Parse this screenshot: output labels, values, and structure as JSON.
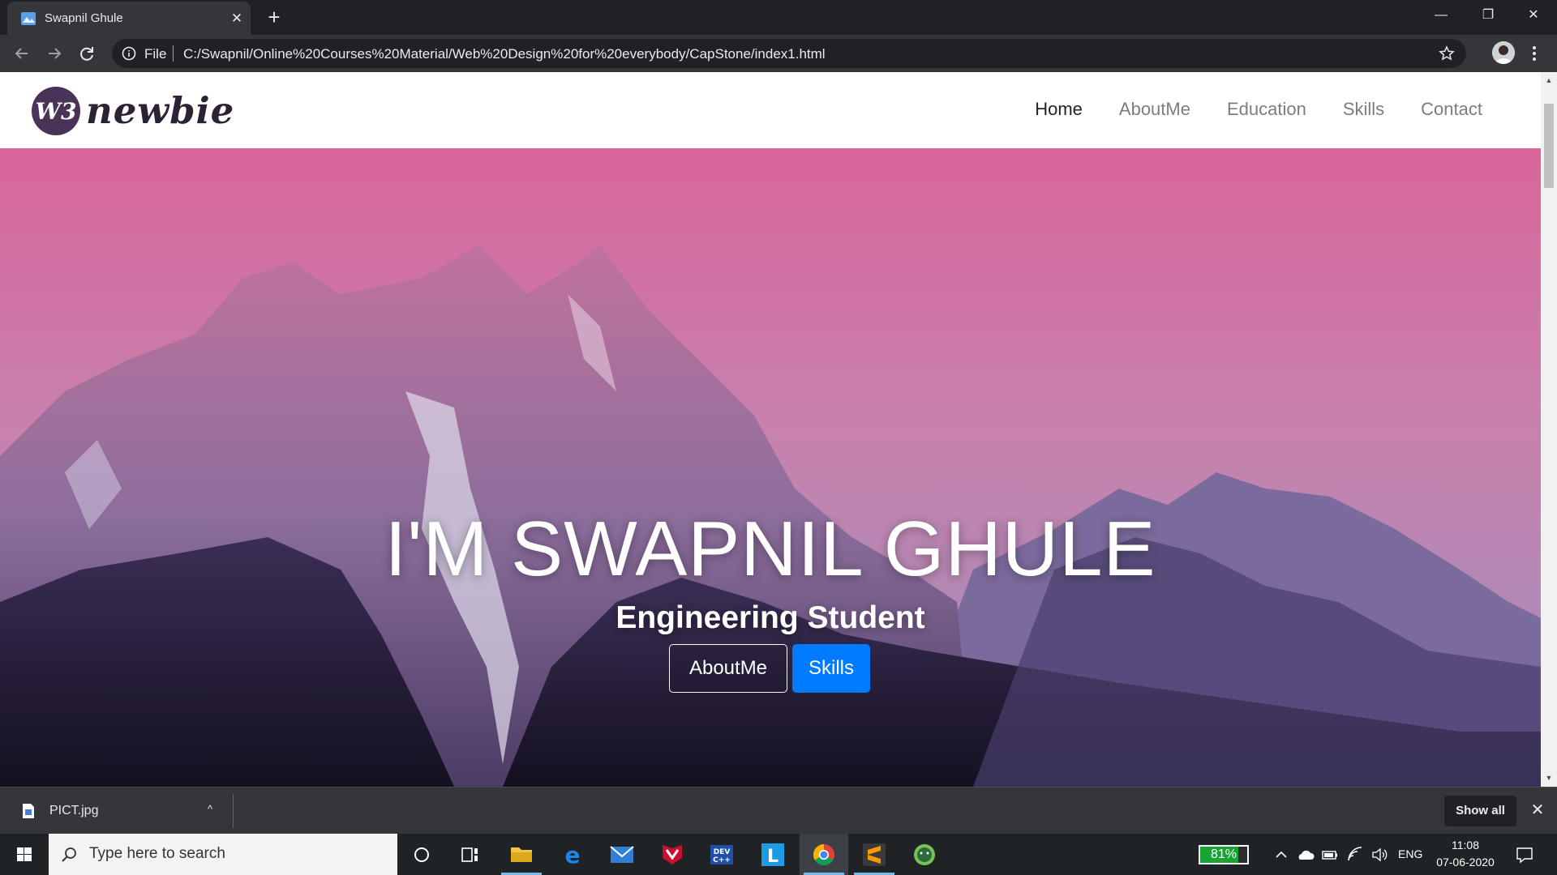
{
  "browser": {
    "tab_title": "Swapnil Ghule",
    "tab_close": "✕",
    "new_tab": "+",
    "url_scheme_label": "File",
    "url": "C:/Swapnil/Online%20Courses%20Material/Web%20Design%20for%20everybody/CapStone/index1.html",
    "window_controls": {
      "minimize": "—",
      "restore": "❐",
      "close": "✕"
    }
  },
  "site": {
    "logo_text": "newbie",
    "logo_mark": "W3",
    "nav": [
      {
        "label": "Home",
        "active": true
      },
      {
        "label": "AboutMe",
        "active": false
      },
      {
        "label": "Education",
        "active": false
      },
      {
        "label": "Skills",
        "active": false
      },
      {
        "label": "Contact",
        "active": false
      }
    ],
    "hero": {
      "title": "I'M SWAPNIL GHULE",
      "subtitle": "Engineering Student",
      "button_outline": "AboutMe",
      "button_primary": "Skills",
      "primary_color": "#007bff",
      "carousel_slides": 3,
      "active_slide": 1
    }
  },
  "download_bar": {
    "file_name": "PICT.jpg",
    "show_all": "Show all",
    "close": "✕",
    "chevron": "^"
  },
  "taskbar": {
    "search_placeholder": "Type here to search",
    "pinned_icons": [
      "cortana-icon",
      "task-view-icon",
      "file-explorer-icon",
      "edge-icon",
      "mail-icon",
      "mcafee-icon",
      "devcpp-icon",
      "l-app-icon",
      "chrome-icon",
      "sublime-text-icon",
      "android-studio-icon"
    ],
    "battery_percent": "81%",
    "battery_level": 0.81,
    "language": "ENG",
    "time": "11:08",
    "date": "07-06-2020"
  }
}
